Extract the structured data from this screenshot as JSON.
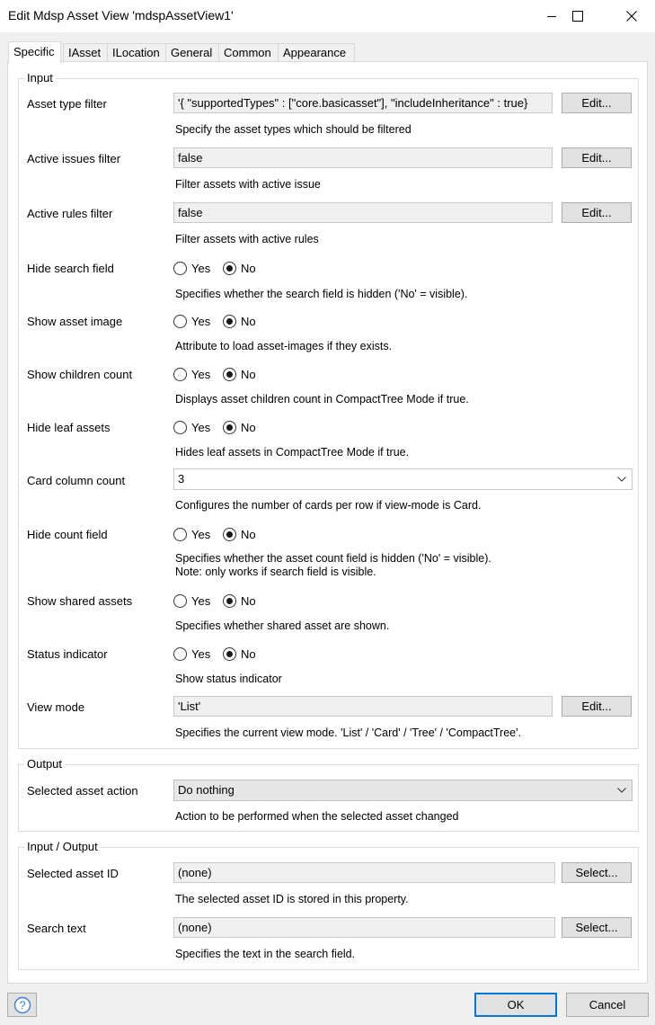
{
  "window": {
    "title": "Edit Mdsp Asset View 'mdspAssetView1'",
    "minimize_icon": "minimize-icon",
    "maximize_icon": "maximize-icon",
    "close_icon": "close-icon"
  },
  "tabs": [
    {
      "label": "Specific",
      "active": true
    },
    {
      "label": "IAsset",
      "active": false
    },
    {
      "label": "ILocation",
      "active": false
    },
    {
      "label": "General",
      "active": false
    },
    {
      "label": "Common",
      "active": false
    },
    {
      "label": "Appearance",
      "active": false
    }
  ],
  "input": {
    "title": "Input",
    "asset_type_filter": {
      "label": "Asset type filter",
      "value": "'{  \"supportedTypes\" : [\"core.basicasset\"],  \"includeInheritance\" : true}",
      "button": "Edit...",
      "desc": "Specify the asset types which should be filtered"
    },
    "active_issues_filter": {
      "label": "Active issues filter",
      "value": "false",
      "button": "Edit...",
      "desc": "Filter assets with active issue"
    },
    "active_rules_filter": {
      "label": "Active rules filter",
      "value": "false",
      "button": "Edit...",
      "desc": "Filter assets with active rules"
    },
    "hide_search_field": {
      "label": "Hide search field",
      "yes": "Yes",
      "no": "No",
      "selected": "No",
      "desc": "Specifies whether the search field is hidden ('No' = visible)."
    },
    "show_asset_image": {
      "label": "Show asset image",
      "yes": "Yes",
      "no": "No",
      "selected": "No",
      "desc": "Attribute to load asset-images if they exists."
    },
    "show_children_count": {
      "label": "Show children count",
      "yes": "Yes",
      "no": "No",
      "selected": "No",
      "desc": "Displays asset children count in CompactTree Mode if true."
    },
    "hide_leaf_assets": {
      "label": "Hide leaf assets",
      "yes": "Yes",
      "no": "No",
      "selected": "No",
      "desc": "Hides leaf assets in CompactTree Mode if true."
    },
    "card_column_count": {
      "label": "Card column count",
      "value": "3",
      "desc": "Configures the number of cards per row if view-mode is Card."
    },
    "hide_count_field": {
      "label": "Hide count field",
      "yes": "Yes",
      "no": "No",
      "selected": "No",
      "desc": "Specifies whether the asset count field is hidden ('No' = visible).",
      "desc2": "Note: only works if search field is visible."
    },
    "show_shared_assets": {
      "label": "Show shared assets",
      "yes": "Yes",
      "no": "No",
      "selected": "No",
      "desc": "Specifies whether shared asset are shown."
    },
    "status_indicator": {
      "label": "Status indicator",
      "yes": "Yes",
      "no": "No",
      "selected": "No",
      "desc": "Show status indicator"
    },
    "view_mode": {
      "label": "View mode",
      "value": "'List'",
      "button": "Edit...",
      "desc": "Specifies the current view mode. 'List' / 'Card' / 'Tree' / 'CompactTree'."
    }
  },
  "output": {
    "title": "Output",
    "selected_asset_action": {
      "label": "Selected asset action",
      "value": "Do nothing",
      "desc": "Action to be performed when the selected asset changed"
    }
  },
  "input_output": {
    "title": "Input / Output",
    "selected_asset_id": {
      "label": "Selected asset ID",
      "value": "(none)",
      "button": "Select...",
      "desc": "The selected asset ID is stored in this property."
    },
    "search_text": {
      "label": "Search text",
      "value": "(none)",
      "button": "Select...",
      "desc": "Specifies the text in the search field."
    }
  },
  "footer": {
    "help_icon": "help-icon",
    "ok": "OK",
    "cancel": "Cancel"
  },
  "colors": {
    "background": "#f0f0f0",
    "panel": "#ffffff",
    "ok_border": "#0078d7",
    "help_blue": "#3b7dd8"
  }
}
